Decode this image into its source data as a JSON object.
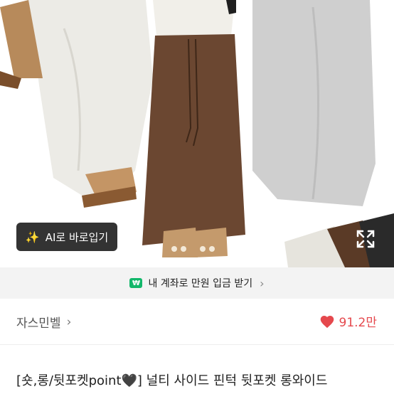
{
  "product_image": {
    "ai_button_label": "AI로 바로입기",
    "icons": [
      "sparkle-wand-icon",
      "expand-icon"
    ]
  },
  "promo_bar": {
    "badge": "₩",
    "text": "내 계좌로 만원 입금 받기",
    "chevron": "›"
  },
  "seller": {
    "name": "자스민벨",
    "chevron": "›"
  },
  "likes": {
    "count": "91.2만",
    "icon": "heart-icon",
    "color": "#e5484d"
  },
  "product": {
    "title": "[숏,롱/뒷포켓point🖤] 널티 사이드 핀턱 뒷포켓 롱와이드"
  }
}
